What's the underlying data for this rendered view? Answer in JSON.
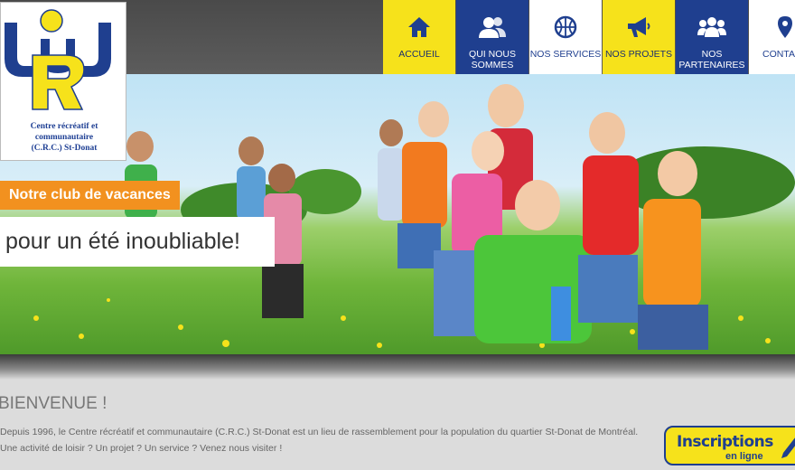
{
  "logo": {
    "letters": "CRC",
    "line1": "Centre récréatif et",
    "line2": "communautaire",
    "line3": "(C.R.C.) St-Donat"
  },
  "nav": [
    {
      "label": "ACCUEIL",
      "icon": "home-icon",
      "style": "yellow"
    },
    {
      "label": "QUI NOUS SOMMES",
      "icon": "people-icon",
      "style": "blue"
    },
    {
      "label": "NOS SERVICES",
      "icon": "basketball-icon",
      "style": "white"
    },
    {
      "label": "NOS PROJETS",
      "icon": "megaphone-icon",
      "style": "yellow"
    },
    {
      "label": "NOS PARTENAIRES",
      "icon": "group-icon",
      "style": "blue"
    },
    {
      "label": "CONTACT",
      "icon": "map-pin-icon",
      "style": "white"
    }
  ],
  "hero": {
    "tagline": "Notre club de vacances",
    "subtitle": "pour un été inoubliable!"
  },
  "content": {
    "title": "BIENVENUE !",
    "intro_line1": "Depuis 1996, le Centre récréatif et communautaire (C.R.C.) St-Donat est un lieu de rassemblement pour la population du quartier St-Donat de Montréal.",
    "intro_line2": "Une activité de loisir ? Un projet ? Un service ? Venez nous visiter !"
  },
  "cta": {
    "main": "Inscriptions",
    "sub": "en ligne"
  },
  "colors": {
    "yellow": "#f6e21b",
    "blue": "#1f3f8f",
    "orange": "#f2911f"
  }
}
